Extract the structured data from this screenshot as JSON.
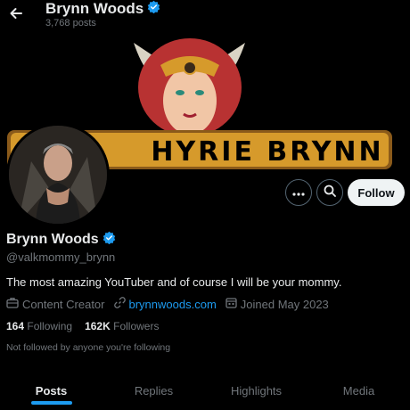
{
  "top": {
    "name": "Brynn Woods",
    "post_count": "3,768 posts"
  },
  "banner": {
    "text": "HYRIE BRYNN"
  },
  "actions": {
    "follow_label": "Follow"
  },
  "profile": {
    "name": "Brynn Woods",
    "handle": "@valkmommy_brynn",
    "bio": "The most amazing YouTuber and of course I will be your mommy.",
    "category": "Content Creator",
    "website": "brynnwoods.com",
    "joined": "Joined May 2023",
    "following_count": "164",
    "following_label": "Following",
    "followers_count": "162K",
    "followers_label": "Followers",
    "not_followed": "Not followed by anyone you're following"
  },
  "tabs": [
    {
      "label": "Posts",
      "active": true
    },
    {
      "label": "Replies",
      "active": false
    },
    {
      "label": "Highlights",
      "active": false
    },
    {
      "label": "Media",
      "active": false
    }
  ],
  "colors": {
    "accent": "#1d9bf0",
    "background": "#000000",
    "muted": "#71767b",
    "text": "#e7e9ea"
  }
}
